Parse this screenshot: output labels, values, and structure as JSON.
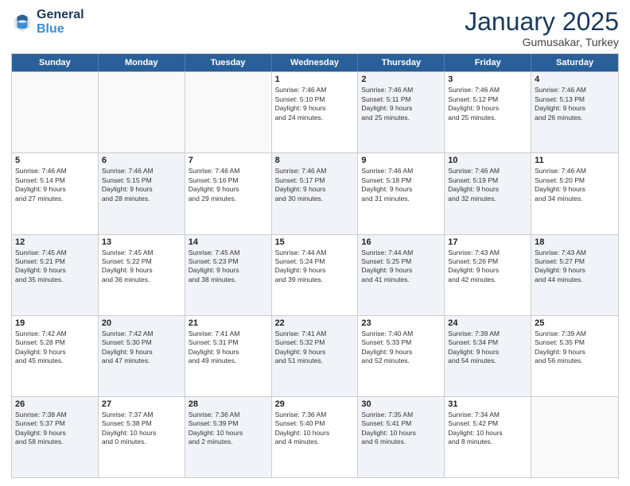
{
  "header": {
    "logo_general": "General",
    "logo_blue": "Blue",
    "month_title": "January 2025",
    "location": "Gumusakar, Turkey"
  },
  "days_of_week": [
    "Sunday",
    "Monday",
    "Tuesday",
    "Wednesday",
    "Thursday",
    "Friday",
    "Saturday"
  ],
  "rows": [
    [
      {
        "day": "",
        "info": "",
        "empty": true
      },
      {
        "day": "",
        "info": "",
        "empty": true
      },
      {
        "day": "",
        "info": "",
        "empty": true
      },
      {
        "day": "1",
        "info": "Sunrise: 7:46 AM\nSunset: 5:10 PM\nDaylight: 9 hours\nand 24 minutes.",
        "shaded": false
      },
      {
        "day": "2",
        "info": "Sunrise: 7:46 AM\nSunset: 5:11 PM\nDaylight: 9 hours\nand 25 minutes.",
        "shaded": true
      },
      {
        "day": "3",
        "info": "Sunrise: 7:46 AM\nSunset: 5:12 PM\nDaylight: 9 hours\nand 25 minutes.",
        "shaded": false
      },
      {
        "day": "4",
        "info": "Sunrise: 7:46 AM\nSunset: 5:13 PM\nDaylight: 9 hours\nand 26 minutes.",
        "shaded": true
      }
    ],
    [
      {
        "day": "5",
        "info": "Sunrise: 7:46 AM\nSunset: 5:14 PM\nDaylight: 9 hours\nand 27 minutes.",
        "shaded": false
      },
      {
        "day": "6",
        "info": "Sunrise: 7:46 AM\nSunset: 5:15 PM\nDaylight: 9 hours\nand 28 minutes.",
        "shaded": true
      },
      {
        "day": "7",
        "info": "Sunrise: 7:46 AM\nSunset: 5:16 PM\nDaylight: 9 hours\nand 29 minutes.",
        "shaded": false
      },
      {
        "day": "8",
        "info": "Sunrise: 7:46 AM\nSunset: 5:17 PM\nDaylight: 9 hours\nand 30 minutes.",
        "shaded": true
      },
      {
        "day": "9",
        "info": "Sunrise: 7:46 AM\nSunset: 5:18 PM\nDaylight: 9 hours\nand 31 minutes.",
        "shaded": false
      },
      {
        "day": "10",
        "info": "Sunrise: 7:46 AM\nSunset: 5:19 PM\nDaylight: 9 hours\nand 32 minutes.",
        "shaded": true
      },
      {
        "day": "11",
        "info": "Sunrise: 7:46 AM\nSunset: 5:20 PM\nDaylight: 9 hours\nand 34 minutes.",
        "shaded": false
      }
    ],
    [
      {
        "day": "12",
        "info": "Sunrise: 7:45 AM\nSunset: 5:21 PM\nDaylight: 9 hours\nand 35 minutes.",
        "shaded": true
      },
      {
        "day": "13",
        "info": "Sunrise: 7:45 AM\nSunset: 5:22 PM\nDaylight: 9 hours\nand 36 minutes.",
        "shaded": false
      },
      {
        "day": "14",
        "info": "Sunrise: 7:45 AM\nSunset: 5:23 PM\nDaylight: 9 hours\nand 38 minutes.",
        "shaded": true
      },
      {
        "day": "15",
        "info": "Sunrise: 7:44 AM\nSunset: 5:24 PM\nDaylight: 9 hours\nand 39 minutes.",
        "shaded": false
      },
      {
        "day": "16",
        "info": "Sunrise: 7:44 AM\nSunset: 5:25 PM\nDaylight: 9 hours\nand 41 minutes.",
        "shaded": true
      },
      {
        "day": "17",
        "info": "Sunrise: 7:43 AM\nSunset: 5:26 PM\nDaylight: 9 hours\nand 42 minutes.",
        "shaded": false
      },
      {
        "day": "18",
        "info": "Sunrise: 7:43 AM\nSunset: 5:27 PM\nDaylight: 9 hours\nand 44 minutes.",
        "shaded": true
      }
    ],
    [
      {
        "day": "19",
        "info": "Sunrise: 7:42 AM\nSunset: 5:28 PM\nDaylight: 9 hours\nand 45 minutes.",
        "shaded": false
      },
      {
        "day": "20",
        "info": "Sunrise: 7:42 AM\nSunset: 5:30 PM\nDaylight: 9 hours\nand 47 minutes.",
        "shaded": true
      },
      {
        "day": "21",
        "info": "Sunrise: 7:41 AM\nSunset: 5:31 PM\nDaylight: 9 hours\nand 49 minutes.",
        "shaded": false
      },
      {
        "day": "22",
        "info": "Sunrise: 7:41 AM\nSunset: 5:32 PM\nDaylight: 9 hours\nand 51 minutes.",
        "shaded": true
      },
      {
        "day": "23",
        "info": "Sunrise: 7:40 AM\nSunset: 5:33 PM\nDaylight: 9 hours\nand 52 minutes.",
        "shaded": false
      },
      {
        "day": "24",
        "info": "Sunrise: 7:39 AM\nSunset: 5:34 PM\nDaylight: 9 hours\nand 54 minutes.",
        "shaded": true
      },
      {
        "day": "25",
        "info": "Sunrise: 7:39 AM\nSunset: 5:35 PM\nDaylight: 9 hours\nand 56 minutes.",
        "shaded": false
      }
    ],
    [
      {
        "day": "26",
        "info": "Sunrise: 7:38 AM\nSunset: 5:37 PM\nDaylight: 9 hours\nand 58 minutes.",
        "shaded": true
      },
      {
        "day": "27",
        "info": "Sunrise: 7:37 AM\nSunset: 5:38 PM\nDaylight: 10 hours\nand 0 minutes.",
        "shaded": false
      },
      {
        "day": "28",
        "info": "Sunrise: 7:36 AM\nSunset: 5:39 PM\nDaylight: 10 hours\nand 2 minutes.",
        "shaded": true
      },
      {
        "day": "29",
        "info": "Sunrise: 7:36 AM\nSunset: 5:40 PM\nDaylight: 10 hours\nand 4 minutes.",
        "shaded": false
      },
      {
        "day": "30",
        "info": "Sunrise: 7:35 AM\nSunset: 5:41 PM\nDaylight: 10 hours\nand 6 minutes.",
        "shaded": true
      },
      {
        "day": "31",
        "info": "Sunrise: 7:34 AM\nSunset: 5:42 PM\nDaylight: 10 hours\nand 8 minutes.",
        "shaded": false
      },
      {
        "day": "",
        "info": "",
        "empty": true
      }
    ]
  ]
}
